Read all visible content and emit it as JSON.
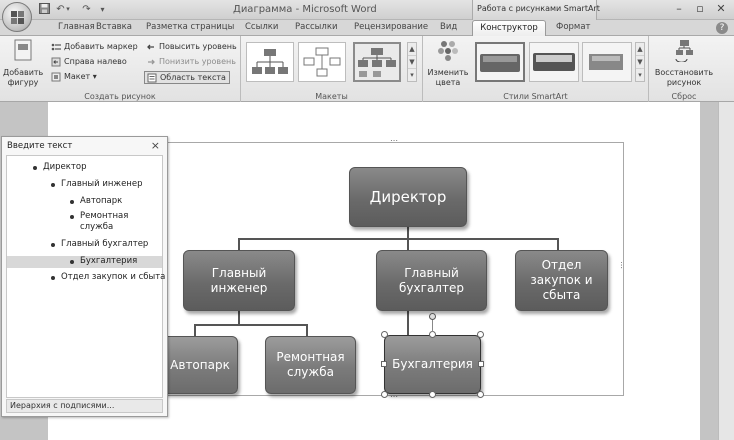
{
  "window": {
    "title": "Диаграмма - Microsoft Word",
    "contextual_group": "Работа с рисунками SmartArt"
  },
  "tabs": [
    "Главная",
    "Вставка",
    "Разметка страницы",
    "Ссылки",
    "Рассылки",
    "Рецензирование",
    "Вид",
    "Конструктор",
    "Формат"
  ],
  "active_tab": "Конструктор",
  "ribbon": {
    "create_graphic": {
      "label": "Создать рисунок",
      "add_shape": "Добавить фигуру",
      "add_bullet": "Добавить маркер",
      "right_to_left": "Справа налево",
      "layout": "Макет",
      "promote": "Повысить уровень",
      "demote": "Понизить уровень",
      "text_pane": "Область текста"
    },
    "layouts": {
      "label": "Макеты"
    },
    "smartart_styles": {
      "label": "Стили SmartArt",
      "change_colors": "Изменить цвета"
    },
    "reset": {
      "label": "Сброс",
      "reset_graphic": "Восстановить рисунок"
    }
  },
  "text_pane": {
    "title": "Введите текст",
    "items": [
      {
        "text": "Директор",
        "level": 1
      },
      {
        "text": "Главный инженер",
        "level": 2
      },
      {
        "text": "Автопарк",
        "level": 3
      },
      {
        "text": "Ремонтная служба",
        "level": 3
      },
      {
        "text": "Главный бухгалтер",
        "level": 2
      },
      {
        "text": "Бухгалтерия",
        "level": 3,
        "selected": true
      },
      {
        "text": "Отдел закупок и сбыта",
        "level": 2
      }
    ],
    "footer": "Иерархия с подписями..."
  },
  "diagram": {
    "root": "Директор",
    "level2": [
      "Главный инженер",
      "Главный бухгалтер",
      "Отдел закупок и сбыта"
    ],
    "level3_engineer": [
      "Автопарк",
      "Ремонтная служба"
    ],
    "level3_accountant": [
      "Бухгалтерия"
    ]
  }
}
